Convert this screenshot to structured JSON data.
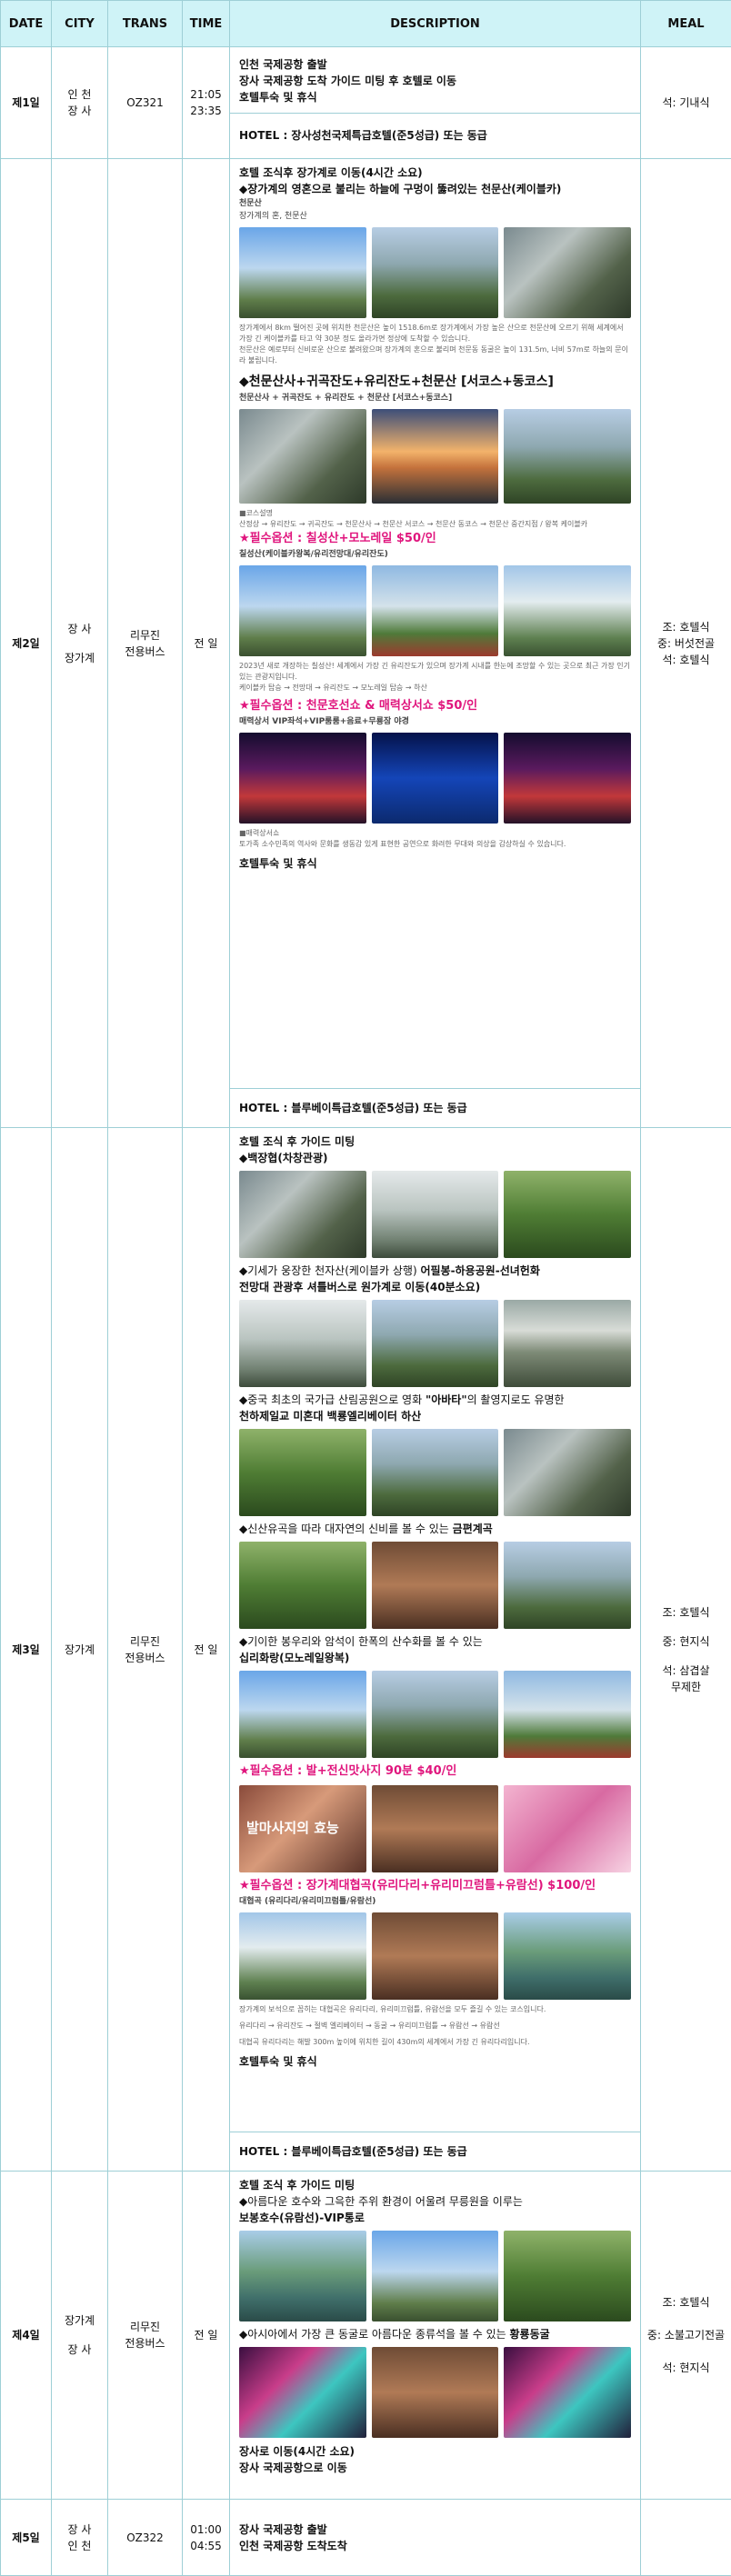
{
  "headers": {
    "date": "DATE",
    "city": "CITY",
    "trans": "TRANS",
    "time": "TIME",
    "description": "DESCRIPTION",
    "meal": "MEAL"
  },
  "day1": {
    "date": "제1일",
    "city": [
      "인 천",
      "장 사"
    ],
    "trans": "OZ321",
    "time": [
      "21:05",
      "23:35"
    ],
    "lines": [
      "인천 국제공항 출발",
      "장사 국제공항 도착 가이드 미팅 후 호텔로 이동",
      "호텔투숙 및 휴식"
    ],
    "hotel": "HOTEL : 장사성천국제특급호텔(준5성급) 또는 동급",
    "meal": [
      "석: 기내식"
    ]
  },
  "day2": {
    "date": "제2일",
    "city": [
      "장 사",
      "장가계"
    ],
    "trans": [
      "리무진",
      "전용버스"
    ],
    "time": "전 일",
    "l1": "호텔 조식후 장가계로 이동(4시간 소요)",
    "l2a": "◆장가계의 영혼으로 불리는 하늘에 구멍이 뚫려있는 ",
    "l2b": "천문산(케이블카)",
    "sub1": "천문산",
    "sub1b": "장가계의 혼, 천문산",
    "note1": "장가계에서 8km 떨어진 곳에 위치한 천문산은 높이 1518.6m로 장가계에서 가장 높은 산으로 천문산에 오르기 위해 세계에서 가장 긴 케이블카를 타고 약 30분 정도 올라가면 정상에 도착할 수 있습니다.",
    "note1b": "천문산은 예로부터 신비로운 산으로 불려왔으며 장가계의 혼으로 불리며 천문동 동굴은 높이 131.5m, 너비 57m로 하늘의 문이라 불립니다.",
    "t2": "◆천문산사+귀곡잔도+유리잔도+천문산 [서코스+동코스]",
    "sub2": "천문산사 + 귀곡잔도 + 유리잔도 + 천문산 [서코스+동코스]",
    "note2": "■코스설명",
    "note2b": "산정상 → 유리잔도 → 귀곡잔도 → 천문산사 → 천문산 서코스 → 천문산 동코스 → 천문산 중간지점 / 왕복 케이블카",
    "opt1": "★필수옵션 : 칠성산+모노레일 $50/인",
    "sub3": "칠성산(케이블카왕복/유리전망대/유리잔도)",
    "note3": "2023년 새로 개장하는 칠성산! 세계에서 가장 긴 유리잔도가 있으며 장가계 시내를 한눈에 조망할 수 있는 곳으로 최근 가장 인기 있는 관광지입니다.",
    "note3b": "케이블카 탑승 → 전망대 → 유리잔도 → 모노레일 탑승 → 하산",
    "opt2": "★필수옵션 : 천문호선쇼 & 매력상서쇼 $50/인",
    "sub4": "매력상서 VIP좌석+VIP룸룸+음료+무룡잠 야경",
    "note4": "■매력상서쇼",
    "note4b": "토가족 소수민족의 역사와 문화를 생동감 있게 표현한 공연으로 화려한 무대와 의상을 감상하실 수 있습니다.",
    "end": "호텔투숙 및 휴식",
    "hotel": "HOTEL : 블루베이특급호텔(준5성급) 또는 동급",
    "meal": [
      "조: 호텔식",
      "중: 버섯전골",
      "석: 호텔식"
    ]
  },
  "day3": {
    "date": "제3일",
    "city": "장가계",
    "trans": [
      "리무진",
      "전용버스"
    ],
    "time": "전 일",
    "l1": "호텔 조식 후 가이드 미팅",
    "l2": "◆백장협(차창관광)",
    "l3a": "◆기세가 웅장한 천자산(케이블카 상행) ",
    "l3b": "어필봉-하용공원-선녀헌화",
    "l3c": "전망대 관광후 셔틀버스로 원가계로 이동(40분소요)",
    "l4a": "◆중국 최초의 국가급 산림공원으로 영화 ",
    "l4b": "\"아바타\"",
    "l4c": "의 촬영지로도 유명한",
    "l4d": "천하제일교 미혼대 백룡엘리베이터 하산",
    "l5a": "◆신산유곡을 따라 대자연의 신비를 볼 수 있는 ",
    "l5b": "금편계곡",
    "l6": "◆기이한 봉우리와 암석이 한폭의 산수화를 볼 수 있는",
    "l6b": "십리화랑(모노레일왕복)",
    "opt1": "★필수옵션 : 발+전신맛사지 90분 $40/인",
    "spa": "발마사지의 효능",
    "opt2": "★필수옵션 : 장가계대협곡(유리다리+유리미끄럼틀+유람선) $100/인",
    "sub1": "대협곡 (유리다리/유리미끄럼틀/유람선)",
    "note1": "장가계의 보석으로 꼽히는 대협곡은 유리다리, 유리미끄럼틀, 유람선을 모두 즐길 수 있는 코스입니다.",
    "note2": "유리다리 → 유리잔도 → 절벽 엘리베이터 → 동굴 → 유리미끄럼틀 → 유람선 → 유람선",
    "note3": "대협곡 유리다리는 해발 300m 높이에 위치한 길이 430m의 세계에서 가장 긴 유리다리입니다.",
    "end": "호텔투숙 및 휴식",
    "hotel": "HOTEL : 블루베이특급호텔(준5성급) 또는 동급",
    "meal": [
      "조: 호텔식",
      "중: 현지식",
      "석: 삼겹살",
      "무제한"
    ]
  },
  "day4": {
    "date": "제4일",
    "city": [
      "장가계",
      "장 사"
    ],
    "trans": [
      "리무진",
      "전용버스"
    ],
    "time": "전 일",
    "l1": "호텔 조식 후 가이드 미팅",
    "l2": "◆아름다운 호수와 그윽한 주위 환경이 어울려 무릉원을 이루는",
    "l2b": "보봉호수(유람선)-VIP통로",
    "l3a": "◆아시아에서 가장 큰 동굴로 아름다운 종류석을 볼 수 있는 ",
    "l3b": "황룡동굴",
    "l4": "장사로 이동(4시간 소요)",
    "l5": "장사 국제공항으로 이동",
    "meal": [
      "조: 호텔식",
      "중: 소불고기전골",
      "석: 현지식"
    ]
  },
  "day5": {
    "date": "제5일",
    "city": [
      "장 사",
      "인 천"
    ],
    "trans": "OZ322",
    "time": [
      "01:00",
      "04:55"
    ],
    "lines": [
      "장사 국제공항 출발",
      "인천 국제공항 도착도착"
    ],
    "meal": []
  }
}
